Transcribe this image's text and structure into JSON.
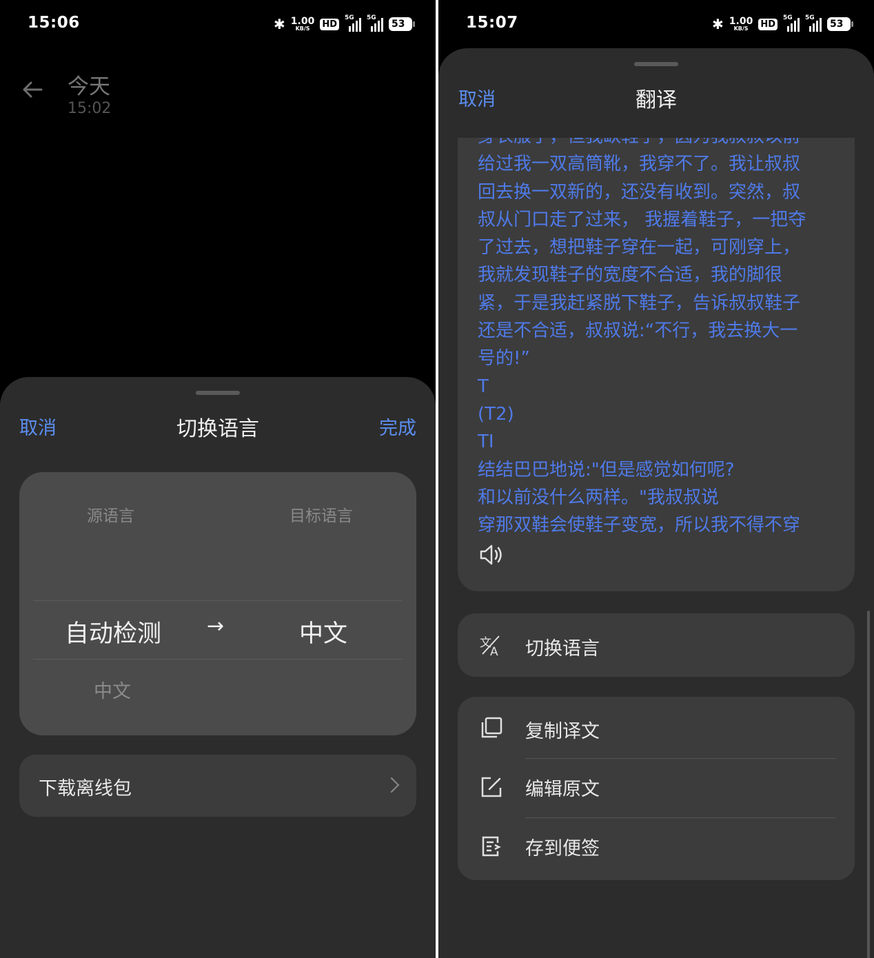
{
  "left": {
    "status": {
      "time": "15:06",
      "speed_value": "1.00",
      "speed_unit": "KB/S",
      "hd": "HD",
      "net1": "5G",
      "net2": "5G",
      "battery": "53"
    },
    "note": {
      "title": "今天",
      "time": "15:02"
    },
    "sheet": {
      "cancel": "取消",
      "title": "切换语言",
      "done": "完成",
      "source_label": "源语言",
      "target_label": "目标语言",
      "source_value": "自动检测",
      "arrow": "→",
      "target_value": "中文",
      "source_next": "中文",
      "download": "下载离线包"
    }
  },
  "right": {
    "status": {
      "time": "15:07",
      "speed_value": "1.00",
      "speed_unit": "KB/S",
      "hd": "HD",
      "net1": "5G",
      "net2": "5G",
      "battery": "53"
    },
    "sheet": {
      "cancel": "取消",
      "title": "翻译",
      "translation_lines": [
        "身衣服了，但我缺鞋子，因为我叔叔以前",
        "给过我一双高筒靴，我穿不了。我让叔叔",
        "回去换一双新的，还没有收到。突然，叔",
        "叔从门口走了过来， 我握着鞋子，一把夺",
        "了过去，想把鞋子穿在一起，可刚穿上，",
        "我就发现鞋子的宽度不合适，我的脚很",
        "紧，于是我赶紧脱下鞋子，告诉叔叔鞋子",
        "还是不合适，叔叔说:“不行，我去换大一",
        "号的!”",
        "T",
        "(T2)",
        "TI",
        "结结巴巴地说:\"但是感觉如何呢?",
        "和以前没什么两样。\"我叔叔说",
        "穿那双鞋会使鞋子变宽，所以我不得不穿"
      ],
      "switch_language": "切换语言",
      "copy": "复制译文",
      "edit": "编辑原文",
      "save": "存到便签"
    }
  },
  "colors": {
    "accent": "#5b8ef0",
    "translation_text": "#4f7ae8",
    "sheet_bg": "#2c2c2c",
    "card_bg": "#3c3c3c"
  }
}
